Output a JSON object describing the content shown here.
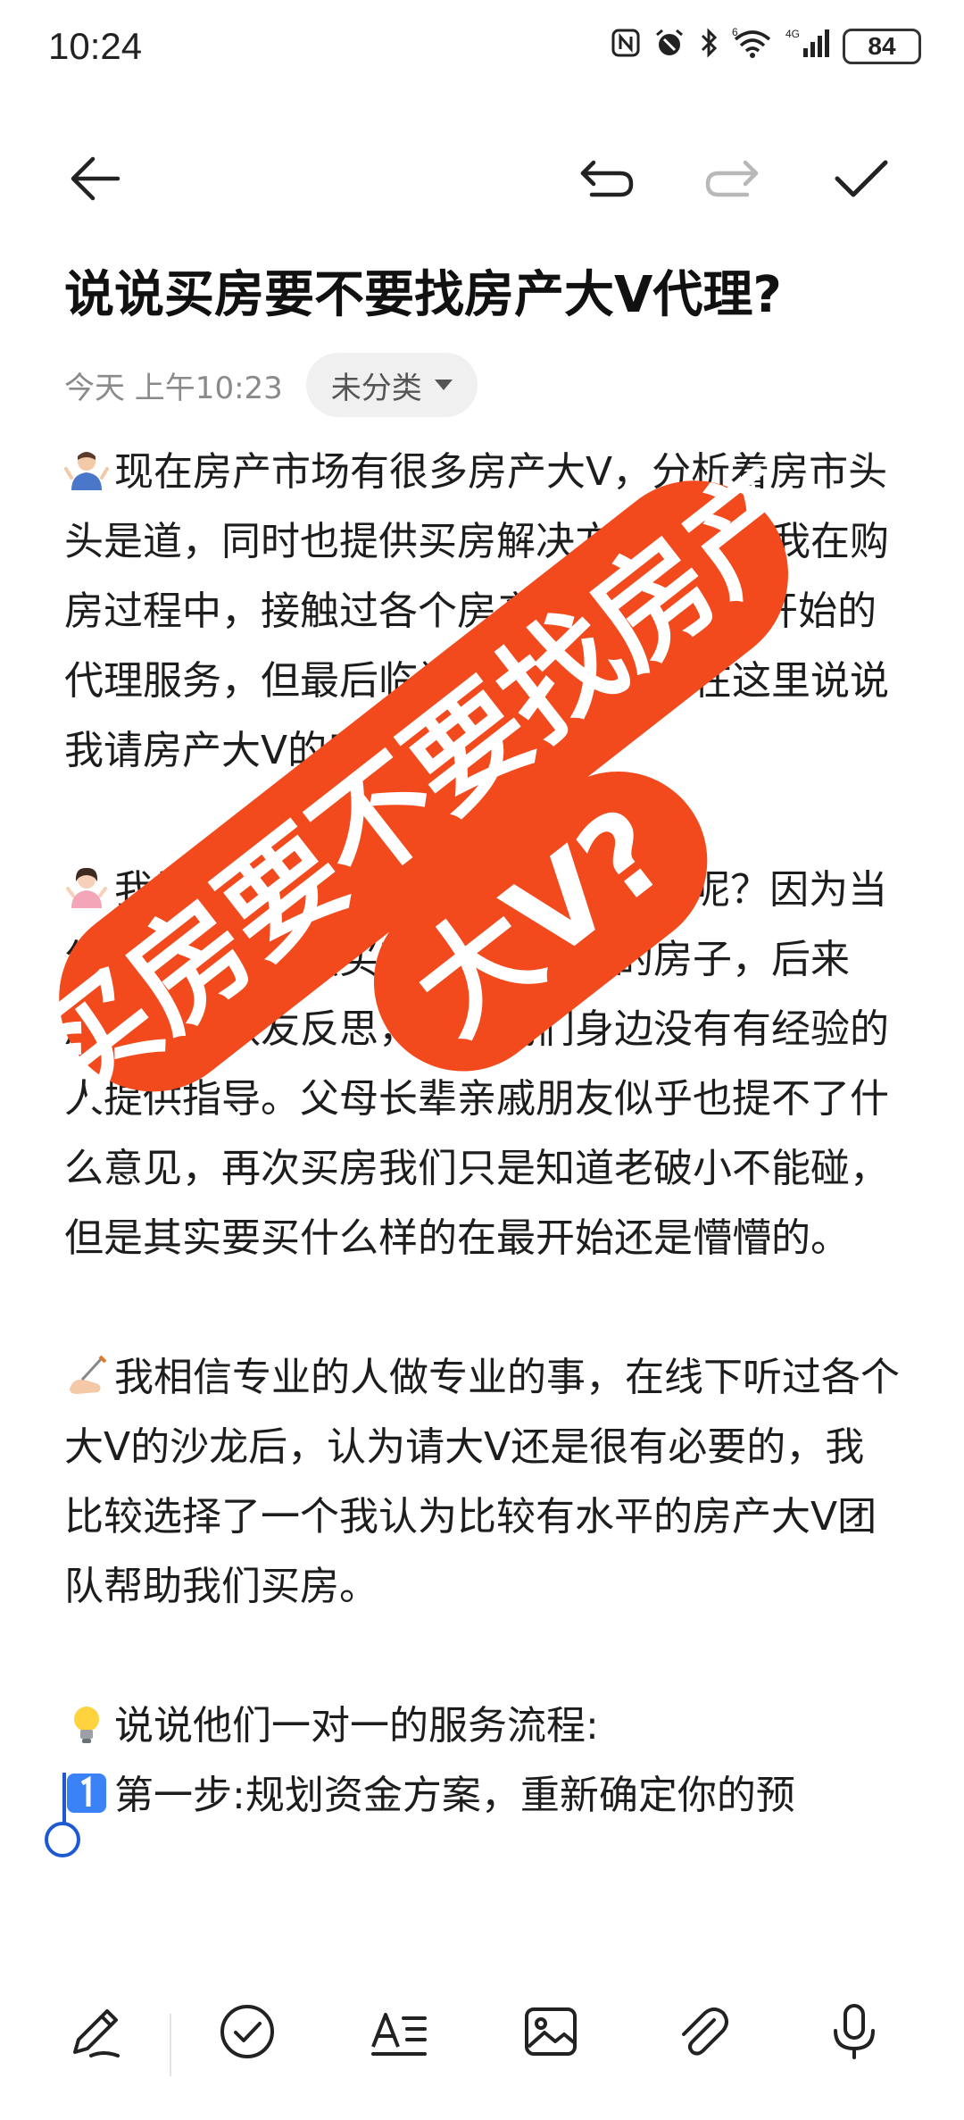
{
  "status_bar": {
    "time": "10:24",
    "battery": "84",
    "icons": [
      "nfc-icon",
      "alarm-icon",
      "bluetooth-icon",
      "wifi-icon",
      "signal-icon",
      "battery-icon"
    ],
    "wifi_label": "6",
    "network_label": "4G"
  },
  "toolbar": {
    "icons": [
      "back-arrow-icon",
      "undo-icon",
      "redo-icon",
      "check-icon"
    ]
  },
  "note": {
    "title": "说说买房要不要找房产大V代理?",
    "date": "今天 上午10:23",
    "category": "未分类",
    "paragraphs": [
      "现在房产市场有很多房产大V，分析着房市头头是道，同时也提供买房解决方案服务。我在购房过程中，接触过各个房产大V，我从一开始的代理服务，但最后临门选择了他们。在这里说说我请房产大V的感受。",
      "我为什么会找房产大V代理我买房呢？因为当年一个头脑一热买了顶层老破小的房子，后来后，我跟队友反思，认为我们身边没有有经验的人提供指导。父母长辈亲戚朋友似乎也提不了什么意见，再次买房我们只是知道老破小不能碰，但是其实要买什么样的在最开始还是懵懵的。",
      "我相信专业的人做专业的事，在线下听过各个大V的沙龙后，认为请大V还是很有必要的，我比较选择了一个我认为比较有水平的房产大V团队帮助我们买房。",
      "说说他们一对一的服务流程:",
      "第一步:规划资金方案，重新确定你的预"
    ]
  },
  "overlay": {
    "line1": "买房要不要找房产",
    "line2": "大V?",
    "color": "#f24a1d"
  },
  "bottom_toolbar": {
    "icons": [
      "pen-icon",
      "checklist-icon",
      "text-format-icon",
      "image-icon",
      "attachment-icon",
      "microphone-icon"
    ]
  }
}
